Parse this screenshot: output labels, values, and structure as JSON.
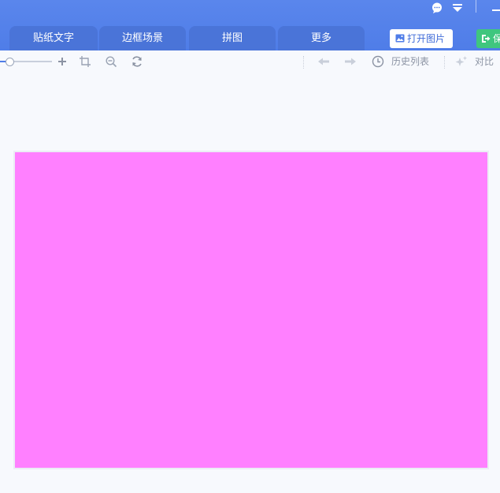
{
  "tabs": [
    {
      "label": "贴纸文字"
    },
    {
      "label": "边框场景"
    },
    {
      "label": "拼图"
    },
    {
      "label": "更多"
    }
  ],
  "header": {
    "open_label": "打开图片",
    "save_label": "保"
  },
  "toolbar": {
    "history_label": "历史列表",
    "compare_label": "对比"
  },
  "colors": {
    "header_blue": "#4f7de8",
    "tab_blue": "#4a74d8",
    "save_green": "#3fc67e",
    "canvas_magenta": "#ff80ff",
    "workspace_bg": "#f7f9fd"
  },
  "icons": {
    "chat": "chat-bubble-icon",
    "dropdown": "caret-down-icon",
    "open": "image-icon",
    "save": "export-icon",
    "zoom_in": "plus-icon",
    "fit": "crop-frame-icon",
    "actual_size": "magnifier-icon",
    "rotate": "rotate-icon",
    "undo": "arrow-left-icon",
    "redo": "arrow-right-icon",
    "history": "clock-icon",
    "compare": "sparkle-icon"
  }
}
